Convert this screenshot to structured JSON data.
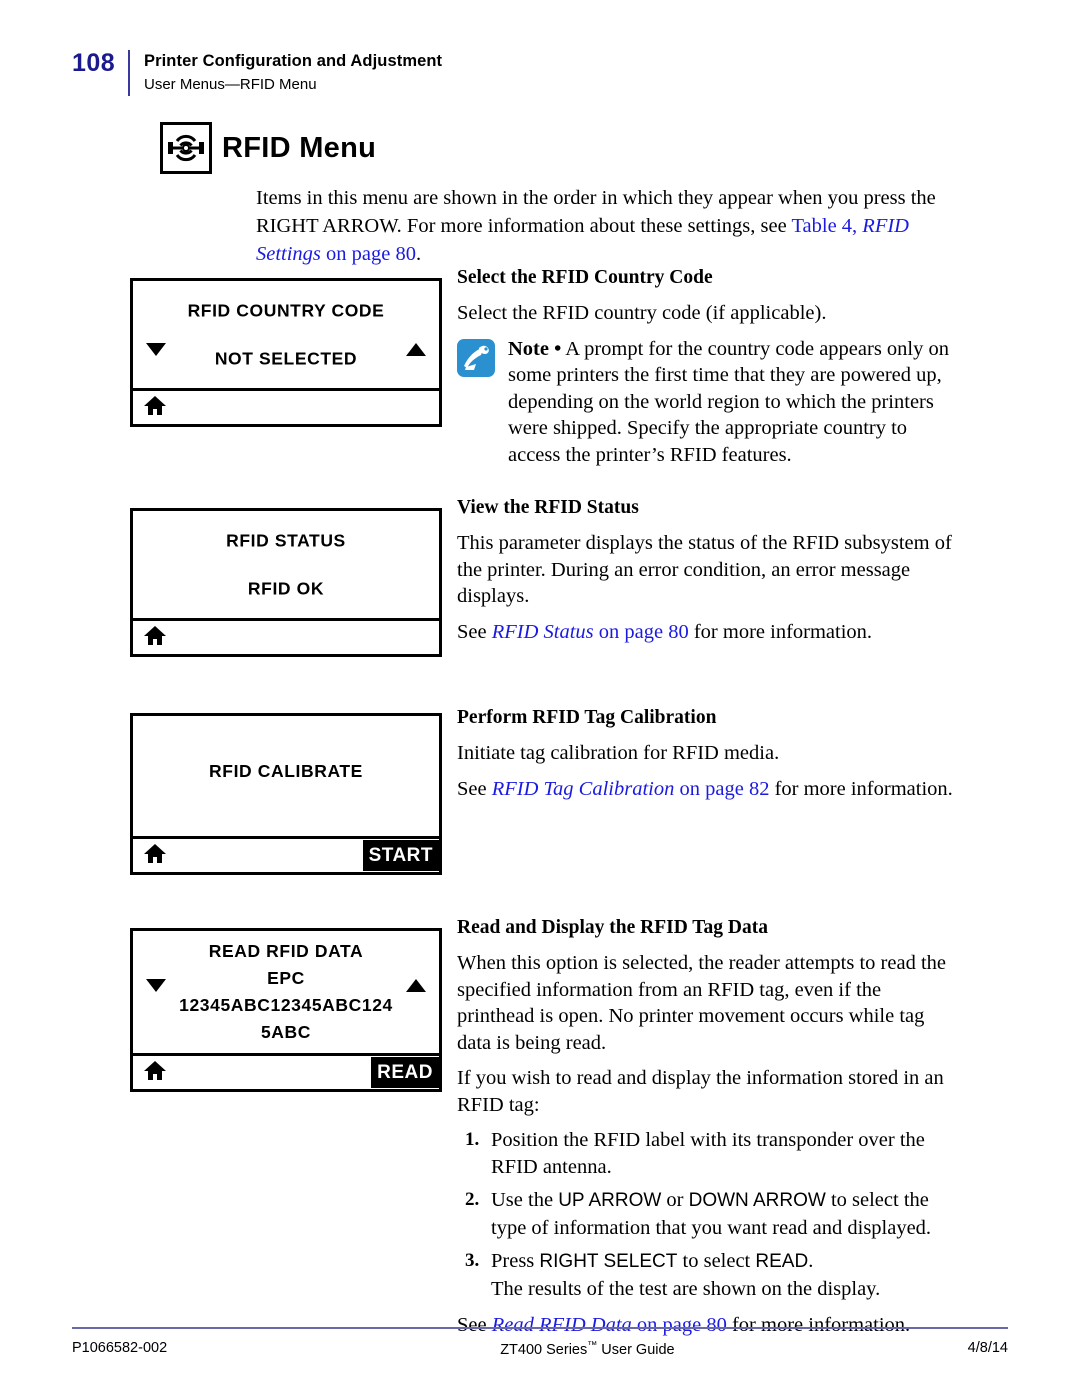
{
  "header": {
    "page_number": "108",
    "title": "Printer Configuration and Adjustment",
    "subtitle": "User Menus—RFID Menu"
  },
  "section": {
    "icon": "rfid-antenna-icon",
    "title": "RFID Menu",
    "intro_part1": "Items in this menu are shown in the order in which they appear when you press the RIGHT ARROW. For more information about these settings, see ",
    "intro_link_plain": "Table 4, ",
    "intro_link_italic": "RFID Settings",
    "intro_link_tail": " on page 80",
    "intro_end": "."
  },
  "panels": [
    {
      "name": "rfid-country-code",
      "lines": [
        "RFID COUNTRY CODE",
        "NOT SELECTED"
      ],
      "has_down_arrow": true,
      "has_up_arrow": true,
      "home_icon": "home-icon",
      "softkey": null
    },
    {
      "name": "rfid-status",
      "lines": [
        "RFID STATUS",
        "RFID OK"
      ],
      "has_down_arrow": false,
      "has_up_arrow": false,
      "home_icon": "home-icon",
      "softkey": null
    },
    {
      "name": "rfid-calibrate",
      "lines": [
        "RFID CALIBRATE"
      ],
      "has_down_arrow": false,
      "has_up_arrow": false,
      "home_icon": "home-icon",
      "softkey": "START"
    },
    {
      "name": "read-rfid-data",
      "lines": [
        "READ RFID DATA",
        "EPC",
        "12345ABC12345ABC124",
        "5ABC"
      ],
      "has_down_arrow": true,
      "has_up_arrow": true,
      "home_icon": "home-icon",
      "softkey": "READ"
    }
  ],
  "sections": {
    "country_code": {
      "heading": "Select the RFID Country Code",
      "para": "Select the RFID country code (if applicable).",
      "note_label": "Note •",
      "note_text": " A prompt for the country code appears only on some printers the first time that they are powered up, depending on the world region to which the printers were shipped. Specify the appropriate country to access the printer’s RFID features."
    },
    "status": {
      "heading": "View the RFID Status",
      "para": "This parameter displays the status of the RFID subsystem of the printer. During an error condition, an error message displays.",
      "see_prefix": "See ",
      "see_italic": "RFID Status",
      "see_page": " on page 80",
      "see_suffix": " for more information."
    },
    "calibration": {
      "heading": "Perform RFID Tag Calibration",
      "para": "Initiate tag calibration for RFID media.",
      "see_prefix": "See ",
      "see_italic": "RFID Tag Calibration",
      "see_page": " on page 82",
      "see_suffix": " for more information."
    },
    "read_data": {
      "heading": "Read and Display the RFID Tag Data",
      "para1": "When this option is selected, the reader attempts to read the specified information from an RFID tag, even if the printhead is open. No printer movement occurs while tag data is being read.",
      "para2": "If you wish to read and display the information stored in an RFID tag:",
      "steps": [
        {
          "num": "1.",
          "text": "Position the RFID label with its transponder over the RFID antenna."
        },
        {
          "num": "2.",
          "pre": "Use the ",
          "kw1": "UP ARROW",
          "mid": " or ",
          "kw2": "DOWN ARROW",
          "post": " to select the type of information that you want read and displayed."
        },
        {
          "num": "3.",
          "pre": "Press ",
          "kw1": "RIGHT SELECT",
          "mid": " to select ",
          "kw2": "READ",
          "post": ".",
          "sub": "The results of the test are shown on the display."
        }
      ],
      "see_prefix": "See ",
      "see_italic": "Read RFID Data",
      "see_page": " on page 80",
      "see_suffix": " for more information."
    }
  },
  "footer": {
    "left": "P1066582-002",
    "center": "ZT400 Series",
    "center_tm": "™",
    "center_tail": " User Guide",
    "right": "4/8/14"
  },
  "colors": {
    "page_number": "#1a1a8e",
    "link": "#1a1ae0",
    "note_icon_bg": "#2b90cf",
    "footer_rule": "#6a6aa8"
  }
}
